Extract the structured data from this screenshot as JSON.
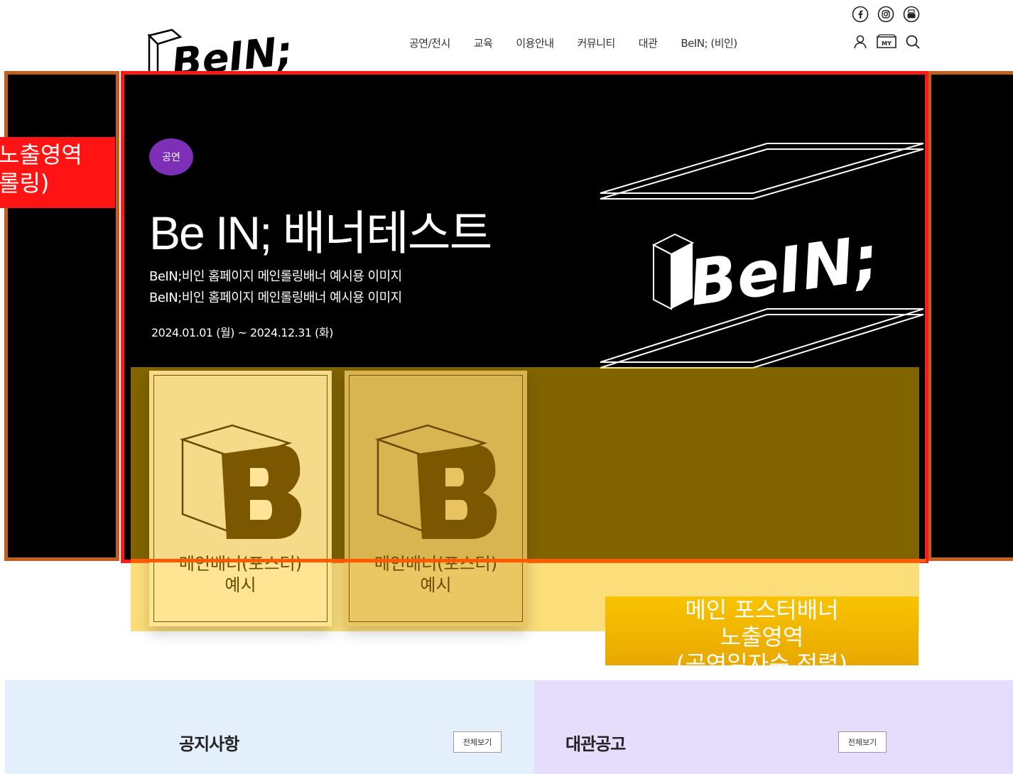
{
  "brand": {
    "logo_text": "BeIN;"
  },
  "gnb": [
    "공연/전시",
    "교육",
    "이용안내",
    "커뮤니티",
    "대관",
    "BeIN; (비인)"
  ],
  "sns_icons": [
    "facebook-icon",
    "instagram-icon",
    "youtube-icon"
  ],
  "util_icons": [
    "user-icon",
    "my-icon",
    "search-icon"
  ],
  "util": {
    "my_label": "MY"
  },
  "annotation": {
    "rolling_label_line1": "노출영역",
    "rolling_label_line2": "롤링)",
    "poster_label_line1": "메인 포스터배너",
    "poster_label_line2": "노출영역",
    "poster_label_line3": "(공연일자순 정렬)"
  },
  "banner": {
    "badge": "공연",
    "title": "Be IN; 배너테스트",
    "desc_line1": "BeIN;비인 홈페이지 메인롤링배너 예시용 이미지",
    "desc_line2": "BeIN;비인 홈페이지 메인롤링배너 예시용 이미지",
    "date": "2024.01.01 (월) ~ 2024.12.31 (화)",
    "art_text": "BeIN;"
  },
  "posters": [
    {
      "caption_line1": "메인배너(포스터)",
      "caption_line2": "예시"
    },
    {
      "caption_line1": "메인배너(포스터)",
      "caption_line2": "예시"
    }
  ],
  "sections": {
    "notice": {
      "title": "공지사항",
      "more": "전체보기"
    },
    "rental": {
      "title": "대관공고",
      "more": "전체보기"
    }
  },
  "colors": {
    "badge": "#7e2fb8",
    "banner_border": "#ff1a1a",
    "side_border": "#c0601e",
    "poster_zone": "#f7bd00",
    "notice_bg": "#e4effc",
    "rental_bg": "#e5ddfb"
  }
}
